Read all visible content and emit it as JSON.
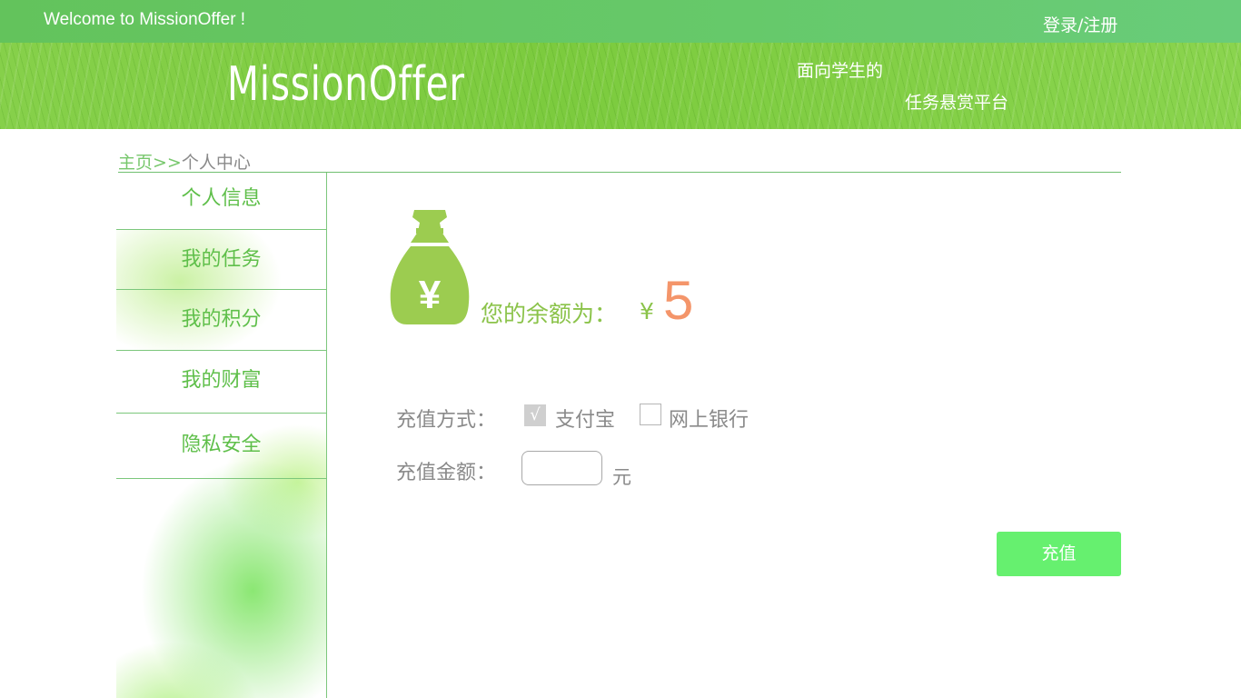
{
  "header": {
    "welcome": "Welcome to MissionOffer !",
    "login_register": "登录/注册"
  },
  "banner": {
    "logo": "MissionOffer",
    "slogan_line1": "面向学生的",
    "slogan_line2": "任务悬赏平台"
  },
  "breadcrumb": {
    "home": "主页",
    "separator": ">>",
    "current": "个人中心"
  },
  "sidebar": {
    "items": [
      {
        "label": "个人信息"
      },
      {
        "label": "我的任务"
      },
      {
        "label": "我的积分"
      },
      {
        "label": "我的财富"
      },
      {
        "label": "隐私安全"
      }
    ],
    "active_item": "我的财富"
  },
  "wealth": {
    "icon": "money-bag-icon",
    "icon_symbol": "¥",
    "balance_label": "您的余额为：",
    "currency": "¥",
    "balance": "5"
  },
  "recharge": {
    "method_label": "充值方式：",
    "methods": [
      {
        "label": "支付宝",
        "checked": true,
        "mark": "√"
      },
      {
        "label": "网上银行",
        "checked": false,
        "mark": ""
      }
    ],
    "amount_label": "充值金额：",
    "amount_value": "",
    "amount_unit": "元",
    "submit_label": "充值"
  },
  "colors": {
    "top_bar": "#63c35c",
    "banner": "#7ccb3e",
    "accent_green": "#5fbf4a",
    "balance_orange": "#f4956a",
    "button_green": "#66f06f"
  }
}
